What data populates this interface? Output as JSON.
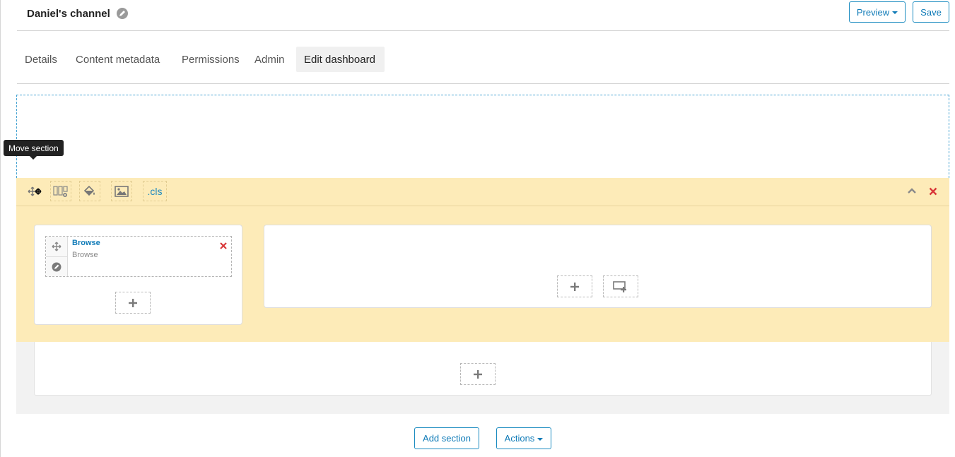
{
  "header": {
    "channel_title": "Daniel's channel",
    "preview_label": "Preview",
    "save_label": "Save"
  },
  "tabs": [
    {
      "label": "Details",
      "active": false
    },
    {
      "label": "Content metadata",
      "active": false
    },
    {
      "label": "Permissions",
      "active": false
    },
    {
      "label": "Admin",
      "active": false
    },
    {
      "label": "Edit dashboard",
      "active": true
    }
  ],
  "tooltip": {
    "text": "Move section"
  },
  "section_toolbar": {
    "tools": [
      "move-icon",
      "columns-settings-icon",
      "paint-bucket-icon",
      "image-icon"
    ],
    "cls_label": ".cls",
    "collapse_icon": "chevron-up-icon",
    "delete_icon": "close-icon"
  },
  "widget": {
    "title": "Browse",
    "subtitle": "Browse"
  },
  "footer": {
    "add_section_label": "Add section",
    "actions_label": "Actions"
  },
  "colors": {
    "accent": "#0e7ab7",
    "section_highlight": "#fdebb8",
    "delete": "#d9383a"
  }
}
